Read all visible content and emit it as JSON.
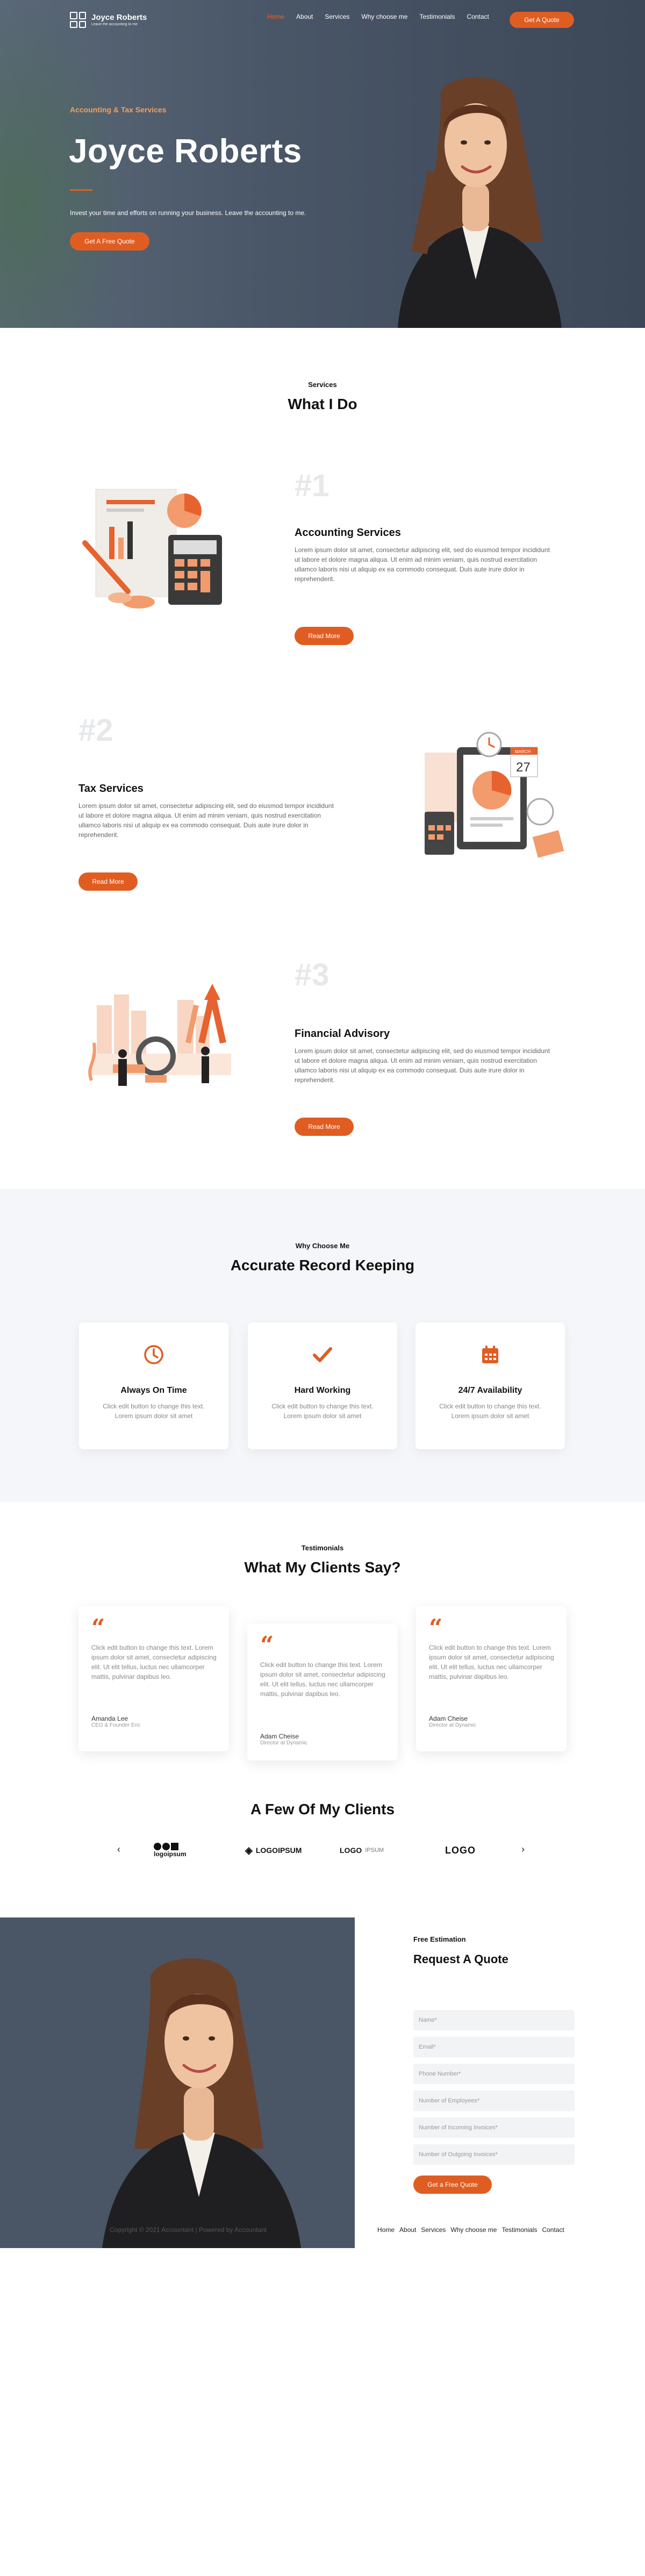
{
  "site": {
    "name": "Joyce Roberts",
    "tagline": "Leave the accounting to me"
  },
  "nav": {
    "items": [
      "Home",
      "About",
      "Services",
      "Why choose me",
      "Testimonials",
      "Contact"
    ],
    "cta": "Get A Quote"
  },
  "hero": {
    "subtitle": "Accounting & Tax Services",
    "title": "Joyce Roberts",
    "description": "Invest your time and efforts on running your business. Leave the accounting to me.",
    "cta": "Get A Free Quote"
  },
  "services": {
    "small": "Services",
    "heading": "What I Do",
    "items": [
      {
        "num": "#1",
        "title": "Accounting Services",
        "desc": "Lorem ipsum dolor sit amet, consectetur adipiscing elit, sed do eiusmod tempor incididunt ut labore et dolore magna aliqua. Ut enim ad minim veniam, quis nostrud exercitation ullamco laboris nisi ut aliquip ex ea commodo consequat. Duis aute irure dolor in reprehenderit.",
        "button": "Read More"
      },
      {
        "num": "#2",
        "title": "Tax Services",
        "desc": "Lorem ipsum dolor sit amet, consectetur adipiscing elit, sed do eiusmod tempor incididunt ut labore et dolore magna aliqua. Ut enim ad minim veniam, quis nostrud exercitation ullamco laboris nisi ut aliquip ex ea commodo consequat. Duis aute irure dolor in reprehenderit.",
        "button": "Read More"
      },
      {
        "num": "#3",
        "title": "Financial Advisory",
        "desc": "Lorem ipsum dolor sit amet, consectetur adipiscing elit, sed do eiusmod tempor incididunt ut labore et dolore magna aliqua. Ut enim ad minim veniam, quis nostrud exercitation ullamco laboris nisi ut aliquip ex ea commodo consequat. Duis aute irure dolor in reprehenderit.",
        "button": "Read More"
      }
    ],
    "calendar_month": "MARCH",
    "calendar_day": "27"
  },
  "why": {
    "small": "Why Choose Me",
    "heading": "Accurate Record Keeping",
    "cards": [
      {
        "icon": "clock-icon",
        "title": "Always On Time",
        "desc": "Click edit button to change this text. Lorem ipsum dolor sit amet"
      },
      {
        "icon": "check-icon",
        "title": "Hard Working",
        "desc": "Click edit button to change this text. Lorem ipsum dolor sit amet"
      },
      {
        "icon": "calendar-icon",
        "title": "24/7 Availability",
        "desc": "Click edit button to change this text. Lorem ipsum dolor sit amet"
      }
    ]
  },
  "testimonials": {
    "small": "Testimonials",
    "heading": "What My Clients Say?",
    "items": [
      {
        "text": "Click edit button to change this text. Lorem ipsum dolor sit amet, consectetur adipiscing elit. Ut elit tellus, luctus nec ullamcorper mattis, pulvinar dapibus leo.",
        "name": "Amanda Lee",
        "role": "CEO & Founder Eric"
      },
      {
        "text": "Click edit button to change this text. Lorem ipsum dolor sit amet, consectetur adipiscing elit. Ut elit tellus, luctus nec ullamcorper mattis, pulvinar dapibus leo.",
        "name": "Adam Cheise",
        "role": "Director at Dynamic"
      },
      {
        "text": "Click edit button to change this text. Lorem ipsum dolor sit amet, consectetur adipiscing elit. Ut elit tellus, luctus nec ullamcorper mattis, pulvinar dapibus leo.",
        "name": "Adam Cheise",
        "role": "Director at Dynamic"
      }
    ]
  },
  "clients": {
    "heading": "A Few Of My Clients",
    "logos": [
      "logoipsum",
      "LOGOIPSUM",
      "LOGO",
      "LOGO"
    ],
    "logo3_sub": "IPSUM"
  },
  "quote": {
    "small": "Free Estimation",
    "heading": "Request A Quote",
    "fields": [
      "Name*",
      "Email*",
      "Phone Number*",
      "Number of Employees*",
      "Number of Incoming Invoices*",
      "Number of Outgoing Invoices*"
    ],
    "button": "Get a Free Quote"
  },
  "footer": {
    "copyright": "Copyright © 2021 Accountant | Powered by Accountant",
    "nav": [
      "Home",
      "About",
      "Services",
      "Why choose me",
      "Testimonials",
      "Contact"
    ]
  },
  "colors": {
    "accent": "#e05d22",
    "hero_bg": "#4a5768",
    "section_gray": "#f4f6f9"
  }
}
